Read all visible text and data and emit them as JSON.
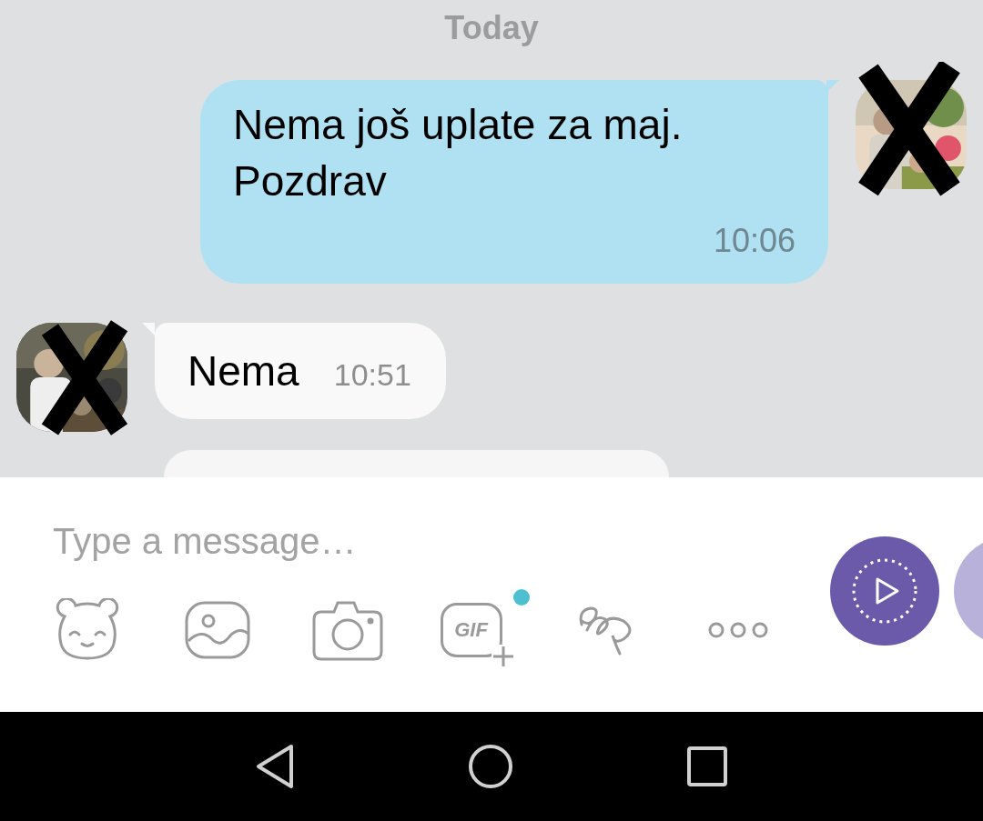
{
  "date_separator": "Today",
  "messages": [
    {
      "kind": "outgoing",
      "text": "Nema još uplate za maj.\nPozdrav",
      "time": "10:06"
    },
    {
      "kind": "incoming",
      "text": "Nema",
      "time": "10:51"
    }
  ],
  "composer": {
    "placeholder": "Type a message…"
  },
  "toolbar": [
    {
      "kind": "sticker",
      "badge": false
    },
    {
      "kind": "gallery",
      "badge": false
    },
    {
      "kind": "camera",
      "badge": false
    },
    {
      "kind": "gif",
      "label": "GIF",
      "badge": true
    },
    {
      "kind": "doodle",
      "badge": false
    },
    {
      "kind": "more",
      "badge": false
    }
  ]
}
